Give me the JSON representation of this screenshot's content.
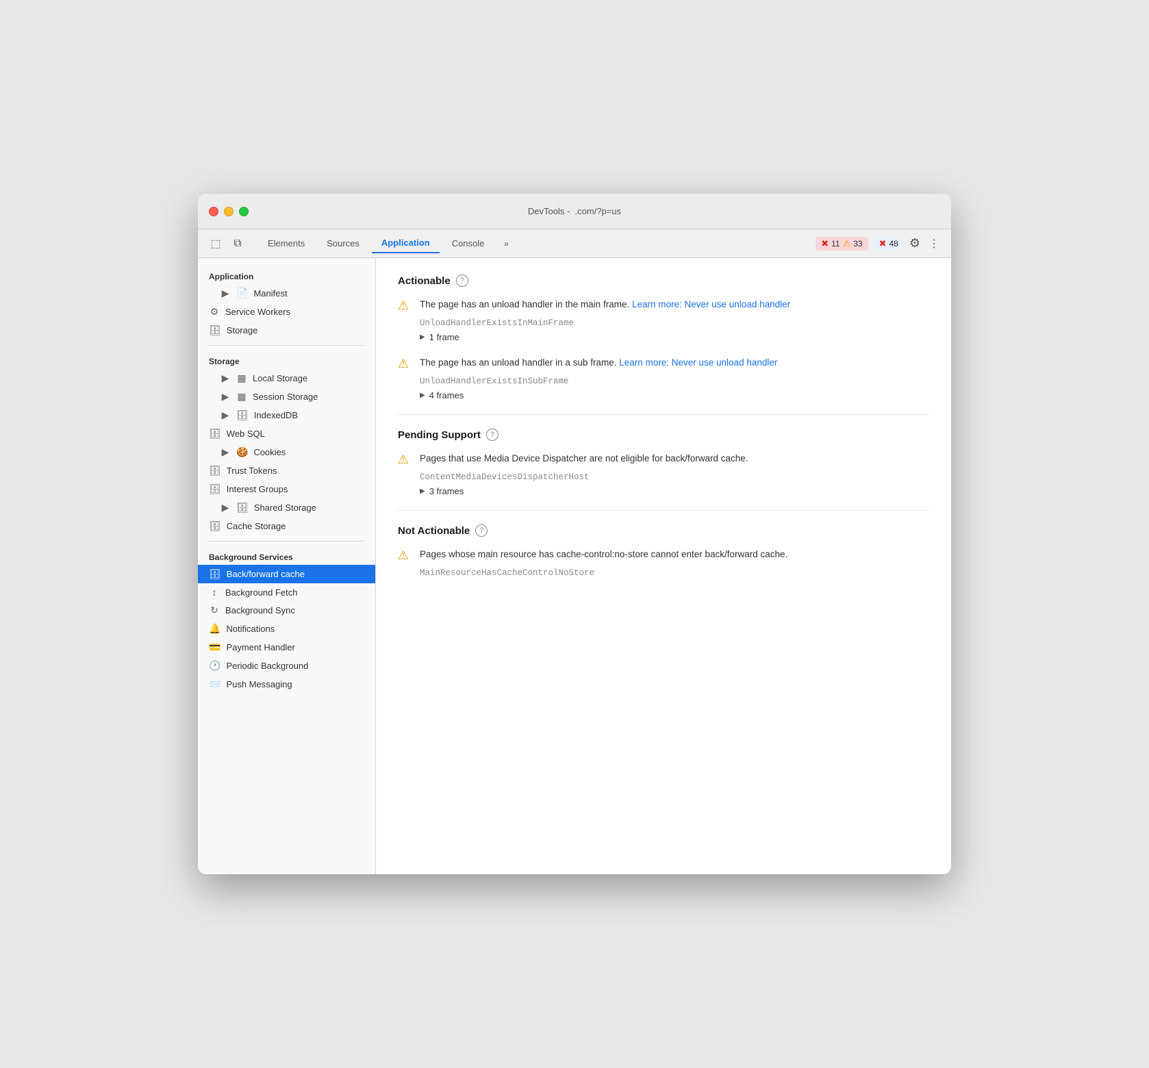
{
  "titlebar": {
    "title": "DevTools -",
    "url": ".com/?p=us"
  },
  "toolbar": {
    "tabs": [
      {
        "label": "Elements",
        "active": false
      },
      {
        "label": "Sources",
        "active": false
      },
      {
        "label": "Application",
        "active": true
      },
      {
        "label": "Console",
        "active": false
      }
    ],
    "badges": [
      {
        "icon": "✖",
        "count": "11",
        "type": "error"
      },
      {
        "icon": "⚠",
        "count": "33",
        "type": "warn"
      },
      {
        "icon": "✖",
        "count": "48",
        "type": "blue"
      }
    ]
  },
  "sidebar": {
    "application_section": "Application",
    "items_application": [
      {
        "label": "Manifest",
        "icon": "📄",
        "indent": 1,
        "has_arrow": true
      },
      {
        "label": "Service Workers",
        "icon": "⚙",
        "indent": 0
      },
      {
        "label": "Storage",
        "icon": "🗄",
        "indent": 0
      }
    ],
    "storage_section": "Storage",
    "items_storage": [
      {
        "label": "Local Storage",
        "icon": "▦",
        "indent": 1,
        "has_arrow": true
      },
      {
        "label": "Session Storage",
        "icon": "▦",
        "indent": 1,
        "has_arrow": true
      },
      {
        "label": "IndexedDB",
        "icon": "🗄",
        "indent": 1,
        "has_arrow": true
      },
      {
        "label": "Web SQL",
        "icon": "🗄",
        "indent": 0
      },
      {
        "label": "Cookies",
        "icon": "🍪",
        "indent": 1,
        "has_arrow": true
      },
      {
        "label": "Trust Tokens",
        "icon": "🗄",
        "indent": 0
      },
      {
        "label": "Interest Groups",
        "icon": "🗄",
        "indent": 0
      },
      {
        "label": "Shared Storage",
        "icon": "🗄",
        "indent": 1,
        "has_arrow": true
      },
      {
        "label": "Cache Storage",
        "icon": "🗄",
        "indent": 0
      }
    ],
    "background_section": "Background Services",
    "items_background": [
      {
        "label": "Back/forward cache",
        "icon": "🗄",
        "indent": 0,
        "active": true
      },
      {
        "label": "Background Fetch",
        "icon": "↕",
        "indent": 0
      },
      {
        "label": "Background Sync",
        "icon": "↻",
        "indent": 0
      },
      {
        "label": "Notifications",
        "icon": "🔔",
        "indent": 0
      },
      {
        "label": "Payment Handler",
        "icon": "💳",
        "indent": 0
      },
      {
        "label": "Periodic Background",
        "icon": "🕐",
        "indent": 0
      },
      {
        "label": "Push Messaging",
        "icon": "📨",
        "indent": 0
      }
    ]
  },
  "content": {
    "sections": [
      {
        "id": "actionable",
        "title": "Actionable",
        "issues": [
          {
            "text": "The page has an unload handler in the main frame.",
            "link_text": "Learn more: Never use unload handler",
            "code": "UnloadHandlerExistsInMainFrame",
            "frames_label": "1 frame"
          },
          {
            "text": "The page has an unload handler in a sub frame.",
            "link_text": "Learn more: Never use unload handler",
            "code": "UnloadHandlerExistsInSubFrame",
            "frames_label": "4 frames"
          }
        ]
      },
      {
        "id": "pending_support",
        "title": "Pending Support",
        "issues": [
          {
            "text": "Pages that use Media Device Dispatcher are not eligible for back/forward cache.",
            "link_text": "",
            "code": "ContentMediaDevicesDispatcherHost",
            "frames_label": "3 frames"
          }
        ]
      },
      {
        "id": "not_actionable",
        "title": "Not Actionable",
        "issues": [
          {
            "text": "Pages whose main resource has cache-control:no-store cannot enter back/forward cache.",
            "link_text": "",
            "code": "MainResourceHasCacheControlNoStore",
            "frames_label": ""
          }
        ]
      }
    ]
  }
}
